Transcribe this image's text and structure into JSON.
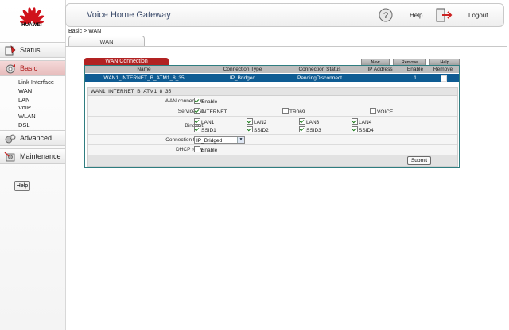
{
  "brand": {
    "logo_text": "HUAWEI",
    "accent": "#b22222",
    "selected_row": "#0f5c93"
  },
  "header": {
    "title": "Voice Home Gateway",
    "help_label": "Help",
    "logout_label": "Logout"
  },
  "breadcrumb": "Basic > WAN",
  "tab": "WAN",
  "sidebar": {
    "status": "Status",
    "basic": "Basic",
    "sub_items": [
      "Link Interface",
      "WAN",
      "LAN",
      "VoIP",
      "WLAN",
      "DSL"
    ],
    "advanced": "Advanced",
    "maintenance": "Maintenance",
    "help_button": "Help"
  },
  "wan": {
    "section_tab": "WAN Connection",
    "buttons": {
      "new": "New",
      "remove": "Remove",
      "help": "Help"
    },
    "columns": [
      "Name",
      "Connection Type",
      "Connection Status",
      "IP Address",
      "Enable",
      "Remove"
    ],
    "rows": [
      {
        "name": "WAN1_INTERNET_B_ATM1_8_35",
        "type": "IP_Bridged",
        "status": "PendingDisconnect",
        "ip": "",
        "enable": "1"
      }
    ]
  },
  "form": {
    "title": "WAN1_INTERNET_B_ATM1_8_35",
    "wan_connection_label": "WAN connection:",
    "wan_connection_enable": "Enable",
    "service_list_label": "Service list:",
    "services": [
      "INTERNET",
      "TR069",
      "VOICE"
    ],
    "bind_list_label": "Bind list:",
    "bind_row1": [
      "LAN1",
      "LAN2",
      "LAN3",
      "LAN4"
    ],
    "bind_row2": [
      "SSID1",
      "SSID2",
      "SSID3",
      "SSID4"
    ],
    "connection_type_label": "Connection type:",
    "connection_type_value": "IP_Bridged",
    "dhcp_relay_label": "DHCP relay:",
    "dhcp_relay_enable": "Enable",
    "submit": "Submit"
  }
}
